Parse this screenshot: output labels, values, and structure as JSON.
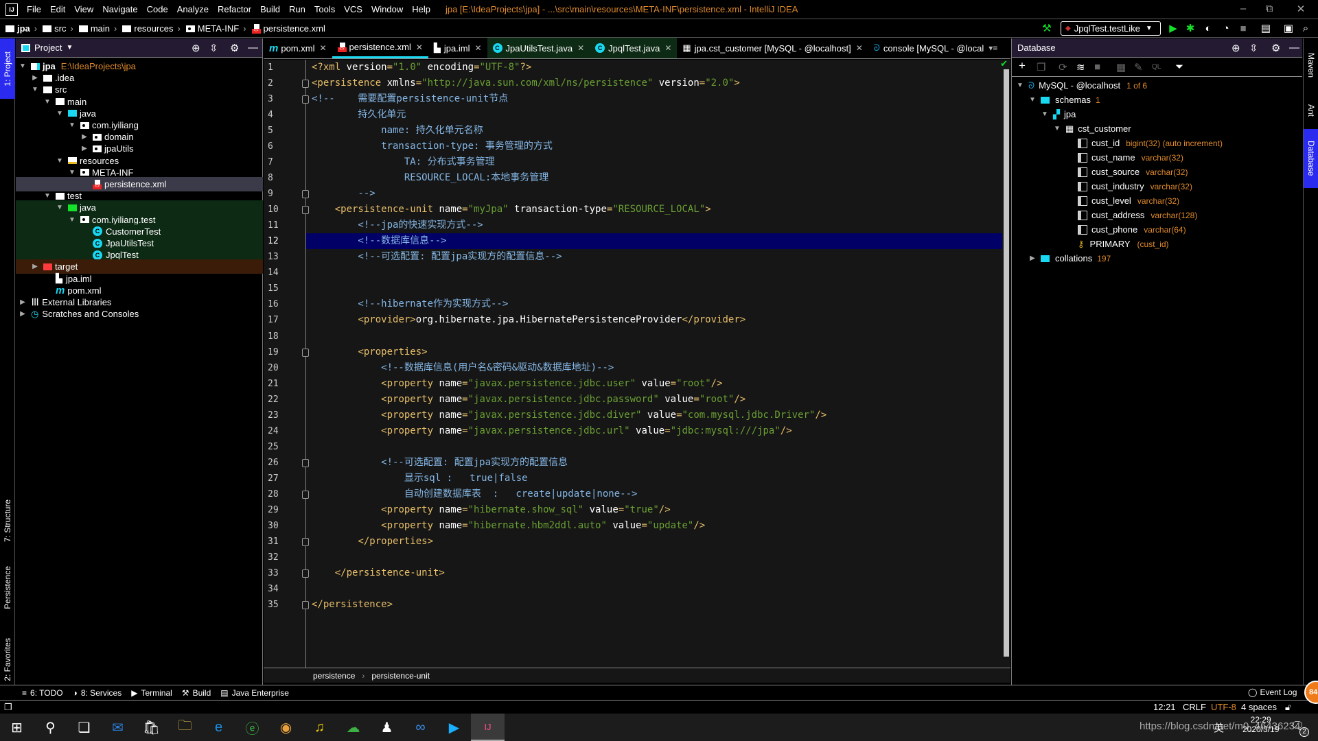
{
  "titlebar": {
    "logo": "IJ",
    "menu": [
      "File",
      "Edit",
      "View",
      "Navigate",
      "Code",
      "Analyze",
      "Refactor",
      "Build",
      "Run",
      "Tools",
      "VCS",
      "Window",
      "Help"
    ],
    "title": "jpa [E:\\IdeaProjects\\jpa] - ...\\src\\main\\resources\\META-INF\\persistence.xml - IntelliJ IDEA",
    "minimize": "–",
    "maximize": "⧉",
    "close": "✕"
  },
  "navbar": {
    "crumbs": [
      "jpa",
      "src",
      "main",
      "resources",
      "META-INF",
      "persistence.xml"
    ],
    "run_config": "JpqlTest.testLike"
  },
  "left_strip": {
    "tabs": [
      "1: Project",
      "7: Structure",
      "Persistence",
      "2: Favorites"
    ]
  },
  "project_panel": {
    "title": "Project",
    "tree": [
      {
        "label": "jpa",
        "extra": "E:\\IdeaProjects\\jpa",
        "depth": 0,
        "arrow": "▼",
        "icon": "module"
      },
      {
        "label": ".idea",
        "depth": 1,
        "arrow": "▶",
        "icon": "folder"
      },
      {
        "label": "src",
        "depth": 1,
        "arrow": "▼",
        "icon": "folder"
      },
      {
        "label": "main",
        "depth": 2,
        "arrow": "▼",
        "icon": "folder"
      },
      {
        "label": "java",
        "depth": 3,
        "arrow": "▼",
        "icon": "src-folder"
      },
      {
        "label": "com.iyiliang",
        "depth": 4,
        "arrow": "▼",
        "icon": "package"
      },
      {
        "label": "domain",
        "depth": 5,
        "arrow": "▶",
        "icon": "package"
      },
      {
        "label": "jpaUtils",
        "depth": 5,
        "arrow": "▶",
        "icon": "package"
      },
      {
        "label": "resources",
        "depth": 3,
        "arrow": "▼",
        "icon": "resources"
      },
      {
        "label": "META-INF",
        "depth": 4,
        "arrow": "▼",
        "icon": "package"
      },
      {
        "label": "persistence.xml",
        "depth": 5,
        "arrow": "",
        "icon": "xml",
        "selected": true
      },
      {
        "label": "test",
        "depth": 2,
        "arrow": "▼",
        "icon": "folder"
      },
      {
        "label": "java",
        "depth": 3,
        "arrow": "▼",
        "icon": "test-folder",
        "test": true
      },
      {
        "label": "com.iyiliang.test",
        "depth": 4,
        "arrow": "▼",
        "icon": "package",
        "test": true
      },
      {
        "label": "CustomerTest",
        "depth": 5,
        "arrow": "",
        "icon": "class",
        "test": true
      },
      {
        "label": "JpaUtilsTest",
        "depth": 5,
        "arrow": "",
        "icon": "class",
        "test": true
      },
      {
        "label": "JpqlTest",
        "depth": 5,
        "arrow": "",
        "icon": "class",
        "test": true
      },
      {
        "label": "target",
        "depth": 1,
        "arrow": "▶",
        "icon": "excluded",
        "excluded": true
      },
      {
        "label": "jpa.iml",
        "depth": 2,
        "arrow": "",
        "icon": "iml"
      },
      {
        "label": "pom.xml",
        "depth": 2,
        "arrow": "",
        "icon": "maven"
      },
      {
        "label": "External Libraries",
        "depth": 0,
        "arrow": "▶",
        "icon": "libraries"
      },
      {
        "label": "Scratches and Consoles",
        "depth": 0,
        "arrow": "▶",
        "icon": "scratches"
      }
    ]
  },
  "editor": {
    "tabs": [
      {
        "label": "pom.xml",
        "icon": "maven"
      },
      {
        "label": "persistence.xml",
        "icon": "xml",
        "active": true
      },
      {
        "label": "jpa.iml",
        "icon": "iml"
      },
      {
        "label": "JpaUtilsTest.java",
        "icon": "class",
        "test": true
      },
      {
        "label": "JpqlTest.java",
        "icon": "class",
        "test": true
      },
      {
        "label": "jpa.cst_customer [MySQL - @localhost]",
        "icon": "table"
      },
      {
        "label": "console [MySQL - @local",
        "icon": "mysql",
        "truncated": true
      }
    ],
    "current_line": 12,
    "lines": [
      [
        [
          "tg",
          "<?xml "
        ],
        [
          "an",
          "version"
        ],
        [
          "tg",
          "="
        ],
        [
          "av",
          "\"1.0\""
        ],
        [
          "an",
          " encoding"
        ],
        [
          "tg",
          "="
        ],
        [
          "av",
          "\"UTF-8\""
        ],
        [
          "tg",
          "?>"
        ]
      ],
      [
        [
          "tg",
          "<persistence "
        ],
        [
          "an",
          "xmlns"
        ],
        [
          "tg",
          "="
        ],
        [
          "av",
          "\"http://java.sun.com/xml/ns/persistence\""
        ],
        [
          "an",
          " version"
        ],
        [
          "tg",
          "="
        ],
        [
          "av",
          "\"2.0\""
        ],
        [
          "tg",
          ">"
        ]
      ],
      [
        [
          "cm",
          "<!--    需要配置persistence-unit节点"
        ]
      ],
      [
        [
          "cm",
          "        持久化单元"
        ]
      ],
      [
        [
          "cm",
          "            name: 持久化单元名称"
        ]
      ],
      [
        [
          "cm",
          "            transaction-type: 事务管理的方式"
        ]
      ],
      [
        [
          "cm",
          "                TA: 分布式事务管理"
        ]
      ],
      [
        [
          "cm",
          "                RESOURCE_LOCAL:本地事务管理"
        ]
      ],
      [
        [
          "cm",
          "        -->"
        ]
      ],
      [
        [
          "tx",
          "    "
        ],
        [
          "tg",
          "<persistence-unit "
        ],
        [
          "an",
          "name"
        ],
        [
          "tg",
          "="
        ],
        [
          "av",
          "\"myJpa\""
        ],
        [
          "an",
          " transaction-type"
        ],
        [
          "tg",
          "="
        ],
        [
          "av",
          "\"RESOURCE_LOCAL\""
        ],
        [
          "tg",
          ">"
        ]
      ],
      [
        [
          "cm",
          "        <!--jpa的快速实现方式-->"
        ]
      ],
      [
        [
          "cm",
          "        <!--数据库信息-->"
        ]
      ],
      [
        [
          "cm",
          "        <!--可选配置: 配置jpa实现方的配置信息-->"
        ]
      ],
      [],
      [],
      [
        [
          "cm",
          "        <!--hibernate作为实现方式-->"
        ]
      ],
      [
        [
          "tx",
          "        "
        ],
        [
          "tg",
          "<provider>"
        ],
        [
          "tx",
          "org.hibernate.jpa.HibernatePersistenceProvider"
        ],
        [
          "tg",
          "</provider>"
        ]
      ],
      [],
      [
        [
          "tx",
          "        "
        ],
        [
          "tg",
          "<properties>"
        ]
      ],
      [
        [
          "cm",
          "            <!--数据库信息(用户名&密码&驱动&数据库地址)-->"
        ]
      ],
      [
        [
          "tx",
          "            "
        ],
        [
          "tg",
          "<property "
        ],
        [
          "an",
          "name"
        ],
        [
          "tg",
          "="
        ],
        [
          "av",
          "\"javax.persistence.jdbc.user\""
        ],
        [
          "an",
          " value"
        ],
        [
          "tg",
          "="
        ],
        [
          "av",
          "\"root\""
        ],
        [
          "tg",
          "/>"
        ]
      ],
      [
        [
          "tx",
          "            "
        ],
        [
          "tg",
          "<property "
        ],
        [
          "an",
          "name"
        ],
        [
          "tg",
          "="
        ],
        [
          "av",
          "\"javax.persistence.jdbc.password\""
        ],
        [
          "an",
          " value"
        ],
        [
          "tg",
          "="
        ],
        [
          "av",
          "\"root\""
        ],
        [
          "tg",
          "/>"
        ]
      ],
      [
        [
          "tx",
          "            "
        ],
        [
          "tg",
          "<property "
        ],
        [
          "an",
          "name"
        ],
        [
          "tg",
          "="
        ],
        [
          "av",
          "\"javax.persistence.jdbc.diver\""
        ],
        [
          "an",
          " value"
        ],
        [
          "tg",
          "="
        ],
        [
          "av",
          "\"com.mysql.jdbc.Driver\""
        ],
        [
          "tg",
          "/>"
        ]
      ],
      [
        [
          "tx",
          "            "
        ],
        [
          "tg",
          "<property "
        ],
        [
          "an",
          "name"
        ],
        [
          "tg",
          "="
        ],
        [
          "av",
          "\"javax.persistence.jdbc.url\""
        ],
        [
          "an",
          " value"
        ],
        [
          "tg",
          "="
        ],
        [
          "av",
          "\"jdbc:mysql:///jpa\""
        ],
        [
          "tg",
          "/>"
        ]
      ],
      [],
      [
        [
          "cm",
          "            <!--可选配置: 配置jpa实现方的配置信息"
        ]
      ],
      [
        [
          "cm",
          "                显示sql :   true|false"
        ]
      ],
      [
        [
          "cm",
          "                自动创建数据库表  :   create|update|none-->"
        ]
      ],
      [
        [
          "tx",
          "            "
        ],
        [
          "tg",
          "<property "
        ],
        [
          "an",
          "name"
        ],
        [
          "tg",
          "="
        ],
        [
          "av",
          "\"hibernate.show_sql\""
        ],
        [
          "an",
          " value"
        ],
        [
          "tg",
          "="
        ],
        [
          "av",
          "\"true\""
        ],
        [
          "tg",
          "/>"
        ]
      ],
      [
        [
          "tx",
          "            "
        ],
        [
          "tg",
          "<property "
        ],
        [
          "an",
          "name"
        ],
        [
          "tg",
          "="
        ],
        [
          "av",
          "\"hibernate.hbm2ddl.auto\""
        ],
        [
          "an",
          " value"
        ],
        [
          "tg",
          "="
        ],
        [
          "av",
          "\"update\""
        ],
        [
          "tg",
          "/>"
        ]
      ],
      [
        [
          "tx",
          "        "
        ],
        [
          "tg",
          "</properties>"
        ]
      ],
      [],
      [
        [
          "tx",
          "    "
        ],
        [
          "tg",
          "</persistence-unit>"
        ]
      ],
      [],
      [
        [
          "tg",
          "</persistence>"
        ]
      ]
    ],
    "fold_lines": [
      2,
      3,
      9,
      10,
      19,
      26,
      28,
      31,
      33,
      35
    ],
    "breadcrumb": [
      "persistence",
      "persistence-unit"
    ]
  },
  "database_panel": {
    "title": "Database",
    "datasource": {
      "label": "MySQL - @localhost",
      "count": "1 of 6"
    },
    "schemas": {
      "label": "schemas",
      "count": "1"
    },
    "schema": "jpa",
    "table": "cst_customer",
    "columns": [
      {
        "name": "cust_id",
        "type": "bigint(32) (auto increment)",
        "key": true
      },
      {
        "name": "cust_name",
        "type": "varchar(32)"
      },
      {
        "name": "cust_source",
        "type": "varchar(32)"
      },
      {
        "name": "cust_industry",
        "type": "varchar(32)"
      },
      {
        "name": "cust_level",
        "type": "varchar(32)"
      },
      {
        "name": "cust_address",
        "type": "varchar(128)"
      },
      {
        "name": "cust_phone",
        "type": "varchar(64)"
      }
    ],
    "index": {
      "name": "PRIMARY",
      "cols": "(cust_id)"
    },
    "collations": {
      "label": "collations",
      "count": "197"
    }
  },
  "right_strip": {
    "tabs": [
      "Maven",
      "Ant",
      "Database"
    ]
  },
  "tool_windows": [
    "6: TODO",
    "8: Services",
    "Terminal",
    "Build",
    "Java Enterprise"
  ],
  "event_log": "Event Log",
  "status": {
    "position": "12:21",
    "line_sep": "CRLF",
    "encoding": "UTF-8",
    "indent": "4 spaces",
    "badge": "84"
  },
  "taskbar": {
    "apps": [
      "start",
      "search",
      "task-view",
      "mail",
      "store",
      "file-explorer",
      "edge",
      "browser-360",
      "chrome",
      "music",
      "wechat",
      "qq",
      "baidu-netdisk",
      "video-player",
      "intellij"
    ],
    "time": "22:29",
    "date": "2020/3/19",
    "ime": "英",
    "notifications": "2",
    "watermark": "https://blog.csdn.net/m0_46436234"
  }
}
